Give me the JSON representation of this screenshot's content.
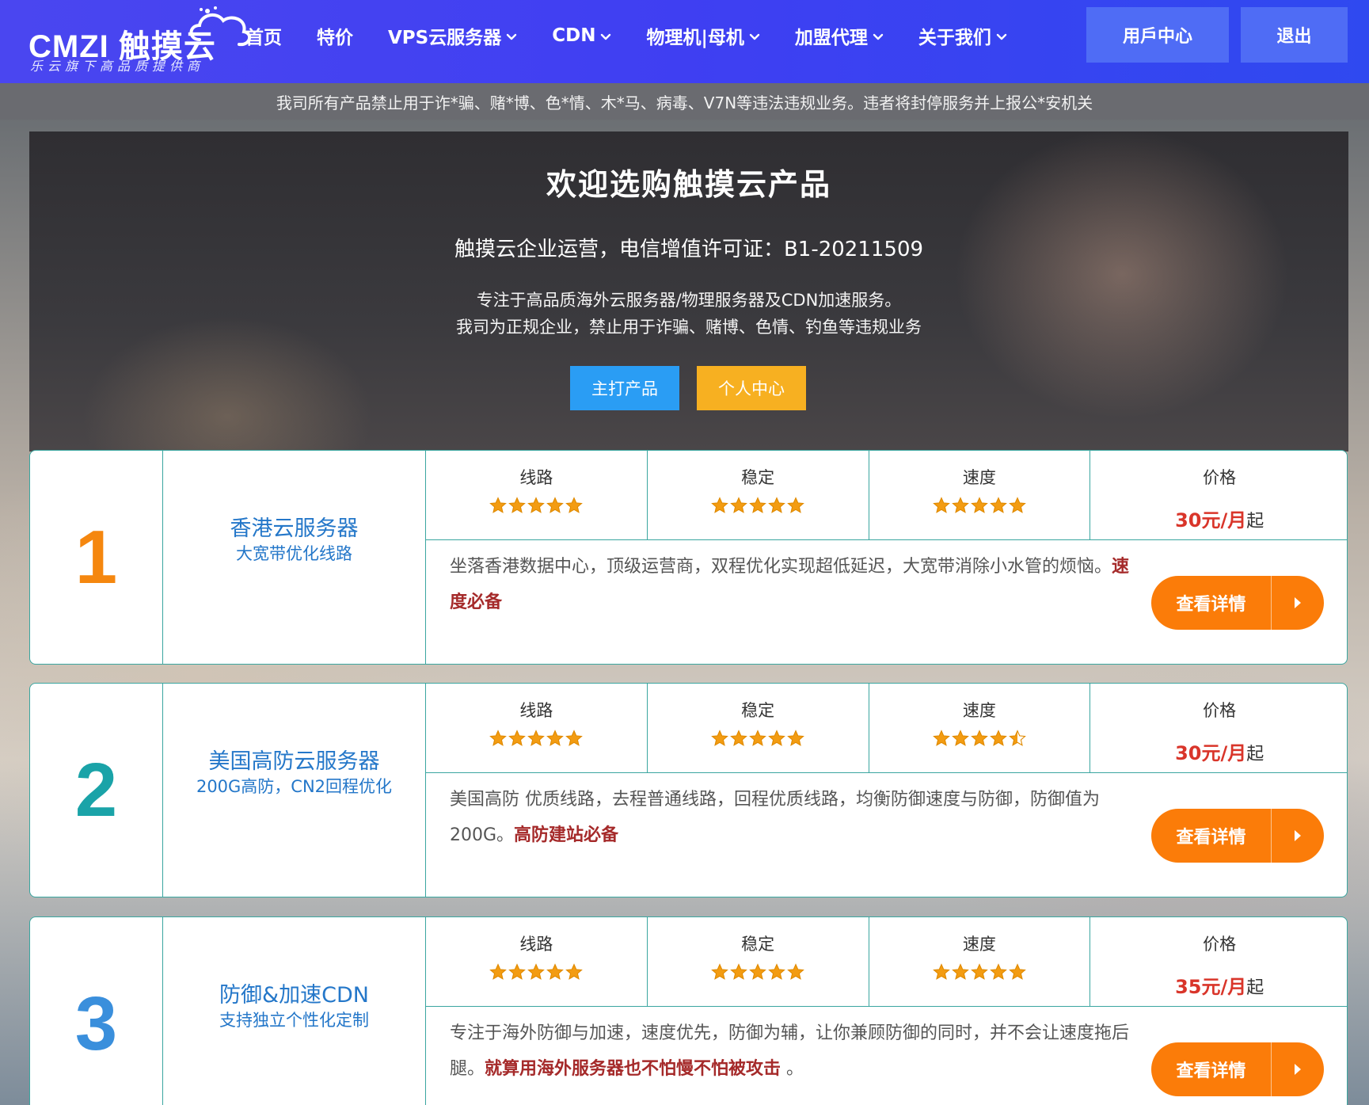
{
  "brand": {
    "logo_text": "CMZI 触摸云",
    "tagline": "乐云旗下高品质提供商"
  },
  "nav": {
    "items": [
      {
        "label": "首页",
        "dropdown": false
      },
      {
        "label": "特价",
        "dropdown": false
      },
      {
        "label": "VPS云服务器",
        "dropdown": true
      },
      {
        "label": "CDN",
        "dropdown": true
      },
      {
        "label": "物理机|母机",
        "dropdown": true
      },
      {
        "label": "加盟代理",
        "dropdown": true
      },
      {
        "label": "关于我们",
        "dropdown": true
      }
    ],
    "user_center": "用戶中心",
    "logout": "退出"
  },
  "notice": "我司所有产品禁止用于诈*骗、赌*博、色*情、木*马、病毒、V7N等违法违规业务。违者将封停服务并上报公*安机关",
  "hero": {
    "title": "欢迎选购触摸云产品",
    "subtitle": "触摸云企业运营，电信增值许可证：B1-20211509",
    "desc_line1": "专注于高品质海外云服务器/物理服务器及CDN加速服务。",
    "desc_line2": "我司为正规企业，禁止用于诈骗、赌博、色情、钓鱼等违规业务",
    "btn_primary": "主打产品",
    "btn_personal": "个人中心"
  },
  "metric_labels": {
    "route": "线路",
    "stability": "稳定",
    "speed": "速度",
    "price": "价格"
  },
  "price_suffix": "起",
  "detail_label": "查看详情",
  "colors": {
    "header": "#3f3ff2",
    "accent_orange": "#fb7c09",
    "price_red": "#d9352a",
    "name_blue": "#2477c9",
    "card_border": "#3aa6a0"
  },
  "products": [
    {
      "rank": "1",
      "rank_color": "#f5870f",
      "name": "香港云服务器",
      "subtitle": "大宽带优化线路",
      "route_stars": 5,
      "stability_stars": 5,
      "speed_stars": 5,
      "price": "30元/月",
      "desc": "坐落香港数据中心，顶级运营商，双程优化实现超低延迟，大宽带消除小水管的烦恼。",
      "highlight": "速度必备",
      "desc_tail": ""
    },
    {
      "rank": "2",
      "rank_color": "#1aa3a8",
      "name": "美国高防云服务器",
      "subtitle": "200G高防，CN2回程优化",
      "route_stars": 5,
      "stability_stars": 5,
      "speed_stars": 4.5,
      "price": "30元/月",
      "desc": "美国高防 优质线路，去程普通线路，回程优质线路，均衡防御速度与防御，防御值为200G。",
      "highlight": "高防建站必备",
      "desc_tail": ""
    },
    {
      "rank": "3",
      "rank_color": "#3a8fdc",
      "name": "防御&加速CDN",
      "subtitle": "支持独立个性化定制",
      "route_stars": 5,
      "stability_stars": 5,
      "speed_stars": 5,
      "price": "35元/月",
      "desc": "专注于海外防御与加速，速度优先，防御为辅，让你兼顾防御的同时，并不会让速度拖后腿。",
      "highlight": "就算用海外服务器也不怕慢不怕被攻击",
      "desc_tail": " 。"
    }
  ]
}
